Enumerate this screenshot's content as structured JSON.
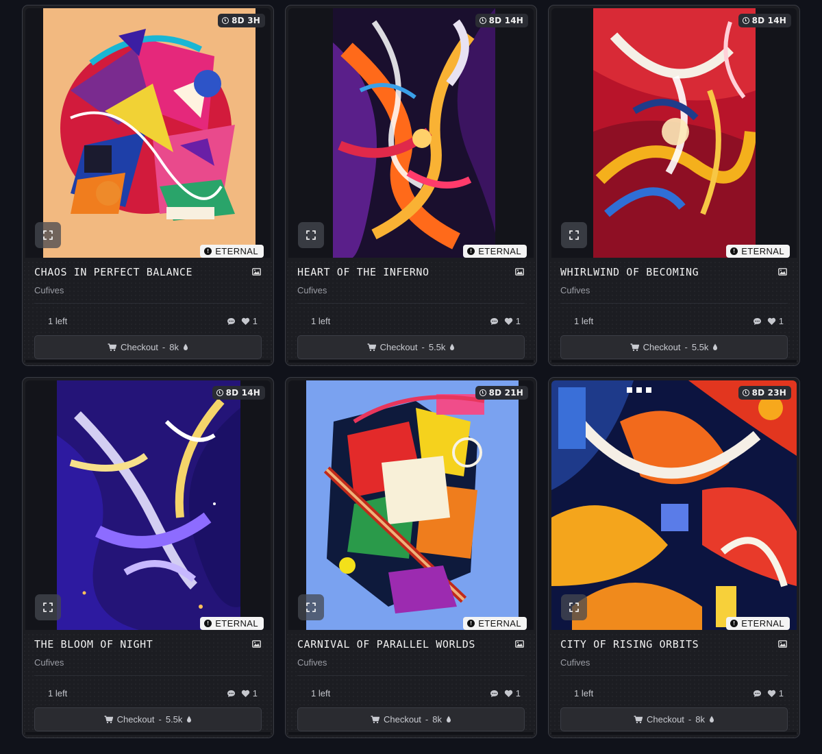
{
  "accent_colors": {
    "background": "#10121a",
    "card": "#1c1d22",
    "badge": "#f4f4f4"
  },
  "cards": [
    {
      "timer": "8D 3H",
      "badge": "ETERNAL",
      "title": "CHAOS IN PERFECT BALANCE",
      "artist": "Cufives",
      "left": "1 left",
      "likes": "1",
      "checkout": {
        "label": "Checkout",
        "sep": "-",
        "price": "8k"
      },
      "icons": [
        "clock-icon",
        "expand-icon",
        "eternal-icon",
        "image-icon",
        "comment-icon",
        "heart-icon",
        "cart-icon",
        "drop-icon"
      ]
    },
    {
      "timer": "8D 14H",
      "badge": "ETERNAL",
      "title": "HEART OF THE INFERNO",
      "artist": "Cufives",
      "left": "1 left",
      "likes": "1",
      "checkout": {
        "label": "Checkout",
        "sep": "-",
        "price": "5.5k"
      }
    },
    {
      "timer": "8D 14H",
      "badge": "ETERNAL",
      "title": "WHIRLWIND OF BECOMING",
      "artist": "Cufives",
      "left": "1 left",
      "likes": "1",
      "checkout": {
        "label": "Checkout",
        "sep": "-",
        "price": "5.5k"
      }
    },
    {
      "timer": "8D 14H",
      "badge": "ETERNAL",
      "title": "THE BLOOM OF NIGHT",
      "artist": "Cufives",
      "left": "1 left",
      "likes": "1",
      "checkout": {
        "label": "Checkout",
        "sep": "-",
        "price": "5.5k"
      }
    },
    {
      "timer": "8D 21H",
      "badge": "ETERNAL",
      "title": "CARNIVAL OF PARALLEL WORLDS",
      "artist": "Cufives",
      "left": "1 left",
      "likes": "1",
      "checkout": {
        "label": "Checkout",
        "sep": "-",
        "price": "8k"
      }
    },
    {
      "timer": "8D 23H",
      "badge": "ETERNAL",
      "title": "CITY OF RISING ORBITS",
      "artist": "Cufives",
      "left": "1 left",
      "likes": "1",
      "checkout": {
        "label": "Checkout",
        "sep": "-",
        "price": "8k"
      }
    }
  ]
}
